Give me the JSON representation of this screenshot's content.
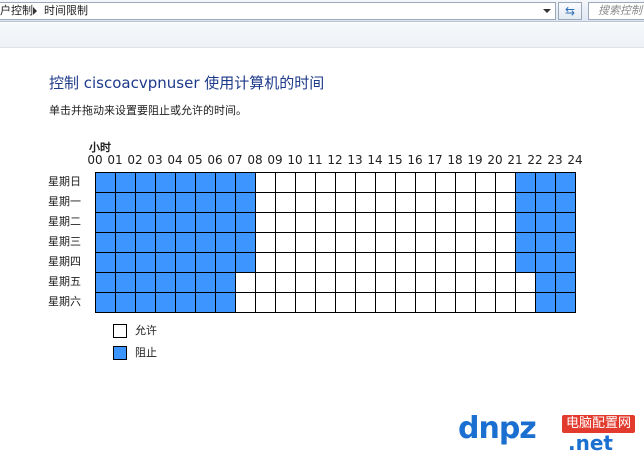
{
  "address_bar": {
    "breadcrumb": [
      "户控制",
      "时间限制"
    ],
    "search_placeholder": "搜索控制"
  },
  "page": {
    "title": "控制 ciscoacvpnuser 使用计算机的时间",
    "instruction": "单击并拖动来设置要阻止或允许的时间。",
    "hours_label": "小时"
  },
  "schedule": {
    "hours": [
      "00",
      "01",
      "02",
      "03",
      "04",
      "05",
      "06",
      "07",
      "08",
      "09",
      "10",
      "11",
      "12",
      "13",
      "14",
      "15",
      "16",
      "17",
      "18",
      "19",
      "20",
      "21",
      "22",
      "23",
      "24"
    ],
    "days": [
      "星期日",
      "星期一",
      "星期二",
      "星期三",
      "星期四",
      "星期五",
      "星期六"
    ],
    "blocked": [
      [
        1,
        1,
        1,
        1,
        1,
        1,
        1,
        1,
        0,
        0,
        0,
        0,
        0,
        0,
        0,
        0,
        0,
        0,
        0,
        0,
        0,
        1,
        1,
        1
      ],
      [
        1,
        1,
        1,
        1,
        1,
        1,
        1,
        1,
        0,
        0,
        0,
        0,
        0,
        0,
        0,
        0,
        0,
        0,
        0,
        0,
        0,
        1,
        1,
        1
      ],
      [
        1,
        1,
        1,
        1,
        1,
        1,
        1,
        1,
        0,
        0,
        0,
        0,
        0,
        0,
        0,
        0,
        0,
        0,
        0,
        0,
        0,
        1,
        1,
        1
      ],
      [
        1,
        1,
        1,
        1,
        1,
        1,
        1,
        1,
        0,
        0,
        0,
        0,
        0,
        0,
        0,
        0,
        0,
        0,
        0,
        0,
        0,
        1,
        1,
        1
      ],
      [
        1,
        1,
        1,
        1,
        1,
        1,
        1,
        1,
        0,
        0,
        0,
        0,
        0,
        0,
        0,
        0,
        0,
        0,
        0,
        0,
        0,
        1,
        1,
        1
      ],
      [
        1,
        1,
        1,
        1,
        1,
        1,
        1,
        0,
        0,
        0,
        0,
        0,
        0,
        0,
        0,
        0,
        0,
        0,
        0,
        0,
        0,
        0,
        1,
        1
      ],
      [
        1,
        1,
        1,
        1,
        1,
        1,
        1,
        0,
        0,
        0,
        0,
        0,
        0,
        0,
        0,
        0,
        0,
        0,
        0,
        0,
        0,
        0,
        1,
        1
      ]
    ],
    "blocked_color": "#3d96ff",
    "allowed_color": "#ffffff"
  },
  "legend": {
    "allow_label": "允许",
    "block_label": "阻止"
  },
  "watermark": {
    "logo": "dnpz",
    "badge": "电脑配置网",
    "domain": ".net"
  }
}
